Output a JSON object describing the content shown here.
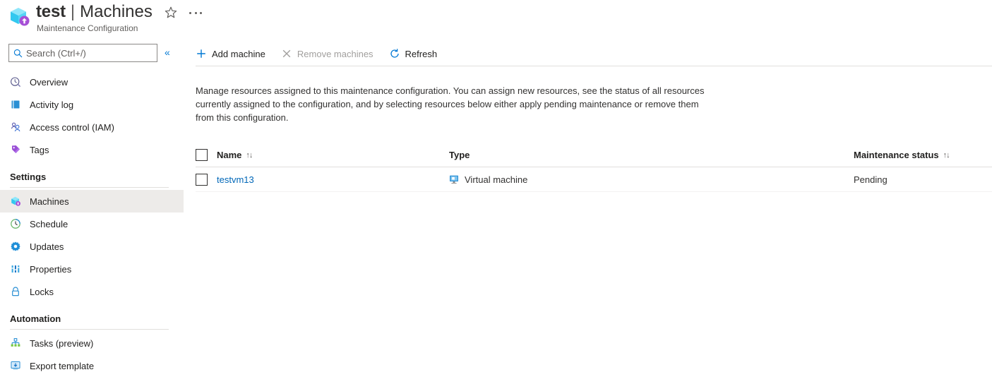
{
  "header": {
    "resource_icon": "maintenance-configuration-icon",
    "title": "test",
    "separator": "|",
    "section": "Machines",
    "subtitle": "Maintenance Configuration",
    "favorite_icon": "star-icon",
    "more_icon": "ellipsis-icon"
  },
  "sidebar": {
    "search": {
      "placeholder": "Search (Ctrl+/)",
      "icon": "search-icon",
      "value": ""
    },
    "collapse_icon": "chevron-double-left-icon",
    "items": [
      {
        "label": "Overview",
        "icon": "overview-icon",
        "type": "item",
        "selected": false
      },
      {
        "label": "Activity log",
        "icon": "activity-log-icon",
        "type": "item",
        "selected": false
      },
      {
        "label": "Access control (IAM)",
        "icon": "access-control-icon",
        "type": "item",
        "selected": false
      },
      {
        "label": "Tags",
        "icon": "tags-icon",
        "type": "item",
        "selected": false
      },
      {
        "label": "Settings",
        "type": "group"
      },
      {
        "label": "Machines",
        "icon": "machines-icon",
        "type": "item",
        "selected": true
      },
      {
        "label": "Schedule",
        "icon": "schedule-clock-icon",
        "type": "item",
        "selected": false
      },
      {
        "label": "Updates",
        "icon": "updates-gear-icon",
        "type": "item",
        "selected": false
      },
      {
        "label": "Properties",
        "icon": "properties-icon",
        "type": "item",
        "selected": false
      },
      {
        "label": "Locks",
        "icon": "lock-icon",
        "type": "item",
        "selected": false
      },
      {
        "label": "Automation",
        "type": "group"
      },
      {
        "label": "Tasks (preview)",
        "icon": "tasks-icon",
        "type": "item",
        "selected": false
      },
      {
        "label": "Export template",
        "icon": "export-template-icon",
        "type": "item",
        "selected": false
      }
    ]
  },
  "toolbar": {
    "commands": [
      {
        "label": "Add machine",
        "icon": "plus-icon",
        "disabled": false
      },
      {
        "label": "Remove machines",
        "icon": "cross-icon",
        "disabled": true
      },
      {
        "label": "Refresh",
        "icon": "refresh-icon",
        "disabled": false
      }
    ]
  },
  "main": {
    "description": "Manage resources assigned to this maintenance configuration. You can assign new resources, see the status of all resources currently assigned to the configuration, and by selecting resources below either apply pending maintenance or remove them from this configuration.",
    "table": {
      "select_all_checked": false,
      "columns": [
        {
          "key": "name",
          "label": "Name",
          "sortable": true
        },
        {
          "key": "type",
          "label": "Type",
          "sortable": false
        },
        {
          "key": "status",
          "label": "Maintenance status",
          "sortable": true
        }
      ],
      "sort_glyph": "↑↓",
      "rows": [
        {
          "checked": false,
          "name": "testvm13",
          "type": "Virtual machine",
          "type_icon": "virtual-machine-icon",
          "status": "Pending"
        }
      ]
    }
  },
  "colors": {
    "link": "#0067b8",
    "accent": "#0078d4",
    "selected_row_bg": "#edebe9",
    "disabled_text": "#a19f9d"
  }
}
